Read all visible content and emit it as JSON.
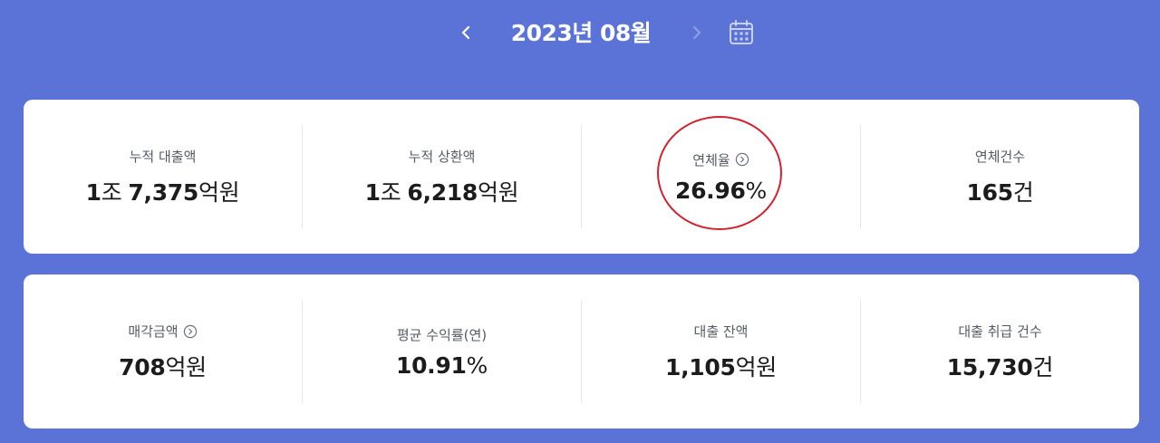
{
  "header": {
    "month_title": "2023년 08월",
    "prev_icon": "chevron-left-icon",
    "next_icon": "chevron-right-icon",
    "calendar_icon": "calendar-icon"
  },
  "summary": [
    {
      "label": "누적 대출액",
      "value_parts": [
        "1",
        "조",
        "7,375",
        "억원"
      ]
    },
    {
      "label": "누적 상환액",
      "value_parts": [
        "1",
        "조",
        "6,218",
        "억원"
      ]
    },
    {
      "label": "연체율",
      "has_info_icon": true,
      "value_parts": [
        "26.96",
        "%"
      ]
    },
    {
      "label": "연체건수",
      "value_parts": [
        "165",
        "건"
      ]
    }
  ],
  "details": [
    {
      "label": "매각금액",
      "has_info_icon": true,
      "value_parts": [
        "708",
        "억원"
      ]
    },
    {
      "label": "평균 수익률(연)",
      "value_parts": [
        "10.91",
        "%"
      ]
    },
    {
      "label": "대출 잔액",
      "value_parts": [
        "1,105",
        "억원"
      ]
    },
    {
      "label": "대출 취급 건수",
      "value_parts": [
        "15,730",
        "건"
      ]
    }
  ],
  "colors": {
    "background": "#5b72d6",
    "card": "#ffffff",
    "highlight_circle": "#d4212d",
    "label_text": "#555b66",
    "value_text": "#1c1c1c"
  }
}
